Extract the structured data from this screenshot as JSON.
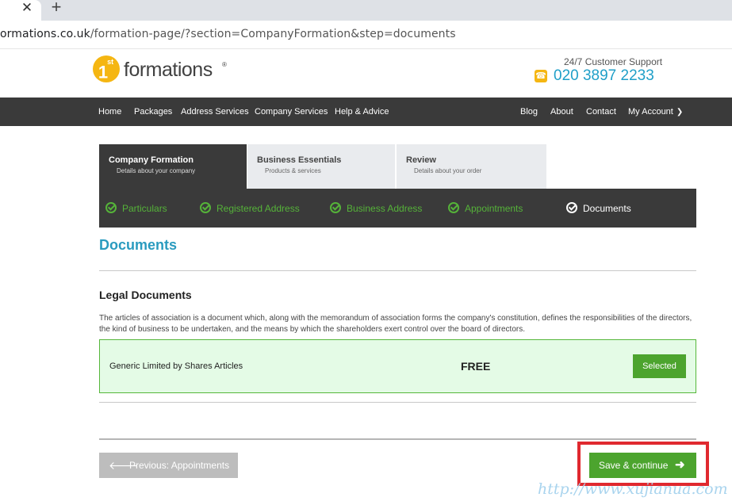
{
  "browser": {
    "new_tab_icon": "plus-icon",
    "close_tab_icon": "close-icon",
    "close_glyph": "✕",
    "plus_glyph": "+",
    "url_domain": "ormations.co.uk",
    "url_path": "/formation-page/?section=CompanyFormation&step=documents"
  },
  "header": {
    "logo_mark": "1",
    "logo_mark_sup": "st",
    "logo_word": "formations",
    "logo_reg": "®",
    "support_label": "24/7 Customer Support",
    "phone_icon": "phone-icon",
    "phone_number": "020 3897 2233"
  },
  "nav": {
    "left": [
      "Home",
      "Packages",
      "Address Services",
      "Company Services",
      "Help & Advice"
    ],
    "right": [
      "Blog",
      "About",
      "Contact",
      "My Account"
    ]
  },
  "steps": [
    {
      "title": "Company Formation",
      "subtitle": "Details about your company"
    },
    {
      "title": "Business Essentials",
      "subtitle": "Products & services"
    },
    {
      "title": "Review",
      "subtitle": "Details about your order"
    }
  ],
  "substeps": [
    "Particulars",
    "Registered Address",
    "Business Address",
    "Appointments",
    "Documents"
  ],
  "main": {
    "page_title": "Documents",
    "section_title": "Legal Documents",
    "description": "The articles of association is a document which, along with the memorandum of association forms the company's constitution, defines the responsibilities of the directors, the kind of business to be undertaken, and the means by which the shareholders exert control over the board of directors.",
    "document": {
      "name": "Generic Limited by Shares Articles",
      "price": "FREE",
      "button": "Selected"
    }
  },
  "footer_buttons": {
    "previous": "Previous: Appointments",
    "save": "Save & continue"
  },
  "watermark": "http://www.xujianua.com",
  "colors": {
    "accent": "#2a9bbf",
    "nav_bg": "#3a3a3a",
    "green": "#4ca42e",
    "highlight": "#e0292f"
  }
}
